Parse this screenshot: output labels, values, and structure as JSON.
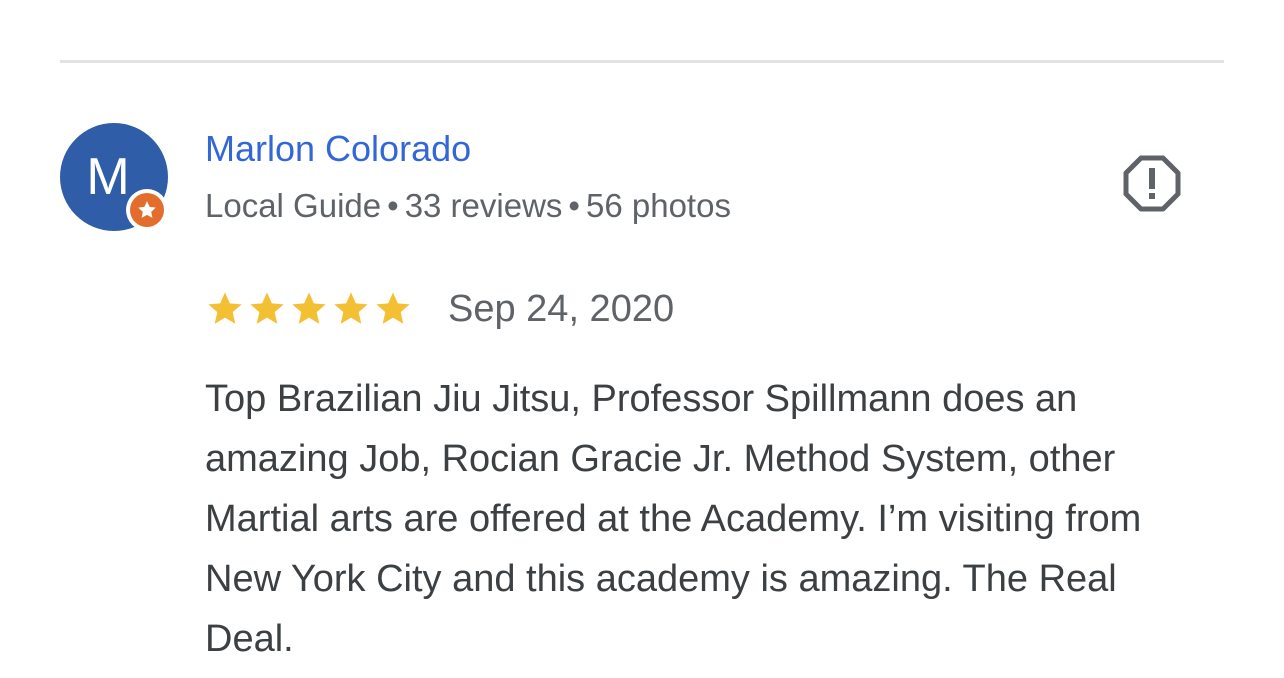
{
  "reviewer": {
    "avatar_letter": "M",
    "name": "Marlon Colorado",
    "badge": "Local Guide",
    "reviews": "33 reviews",
    "photos": "56 photos",
    "separator": "•"
  },
  "review": {
    "rating": 5,
    "date": "Sep 24, 2020",
    "text": "Top Brazilian Jiu Jitsu, Professor Spillmann does an amazing Job, Rocian Gracie Jr. Method System, other Martial arts are offered at the Academy. I’m visiting from New York City and this academy is amazing. The Real Deal."
  },
  "icons": {
    "report": "report-flag-icon",
    "star": "star-icon",
    "local_guide_badge": "local-guide-star-icon"
  },
  "colors": {
    "name": "#3367d6",
    "avatar_bg": "#2f5da8",
    "star": "#f4c033",
    "badge": "#e26d2c"
  }
}
